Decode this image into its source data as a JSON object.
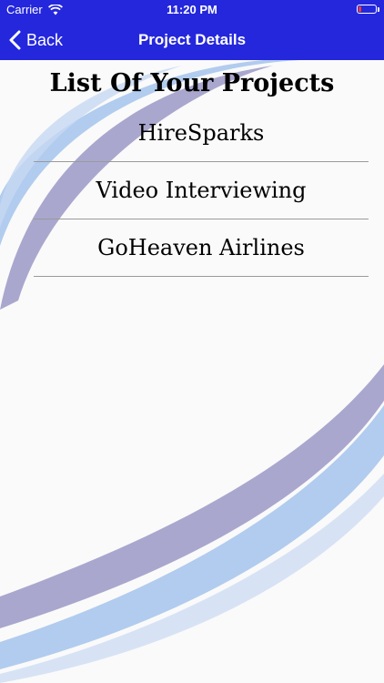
{
  "status_bar": {
    "carrier": "Carrier",
    "time": "11:20 PM"
  },
  "nav": {
    "back_label": "Back",
    "title": "Project Details"
  },
  "page": {
    "heading": "List Of Your Projects",
    "projects": [
      "HireSparks",
      "Video Interviewing",
      "GoHeaven Airlines"
    ]
  },
  "colors": {
    "nav_background": "#2427dc",
    "swoosh_purple": "#9a98c6",
    "swoosh_blue": "#a9c6ec"
  }
}
